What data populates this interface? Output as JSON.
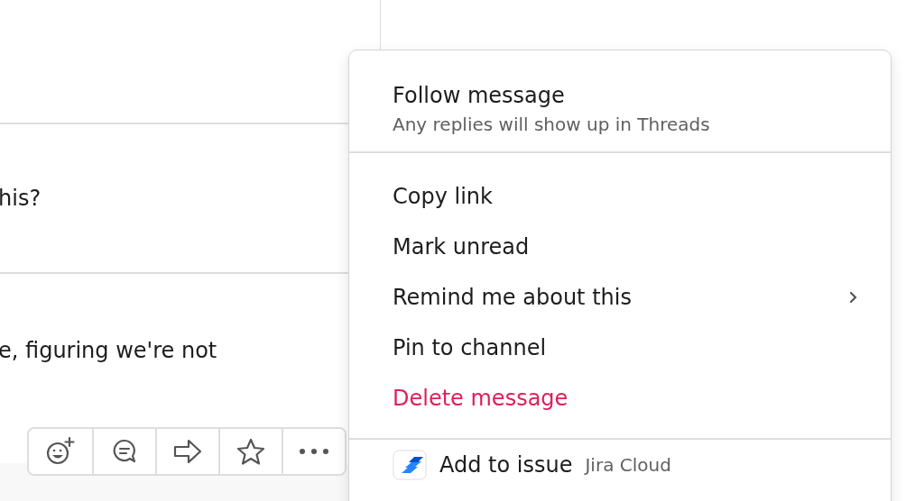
{
  "messages": [
    {
      "text": "his?"
    },
    {
      "text": "e, figuring we're not"
    }
  ],
  "message_actions": [
    {
      "kind": "reaction"
    },
    {
      "kind": "thread"
    },
    {
      "kind": "share"
    },
    {
      "kind": "save"
    },
    {
      "kind": "more"
    }
  ],
  "context_menu": {
    "follow": {
      "label": "Follow message",
      "description": "Any replies will show up in Threads"
    },
    "items": [
      {
        "label": "Copy link",
        "kind": "normal",
        "submenu": false
      },
      {
        "label": "Mark unread",
        "kind": "normal",
        "submenu": false
      },
      {
        "label": "Remind me about this",
        "kind": "normal",
        "submenu": true
      },
      {
        "label": "Pin to channel",
        "kind": "normal",
        "submenu": false
      },
      {
        "label": "Delete message",
        "kind": "danger",
        "submenu": false
      }
    ],
    "apps": [
      {
        "label": "Add to issue",
        "app": "Jira Cloud"
      }
    ]
  }
}
